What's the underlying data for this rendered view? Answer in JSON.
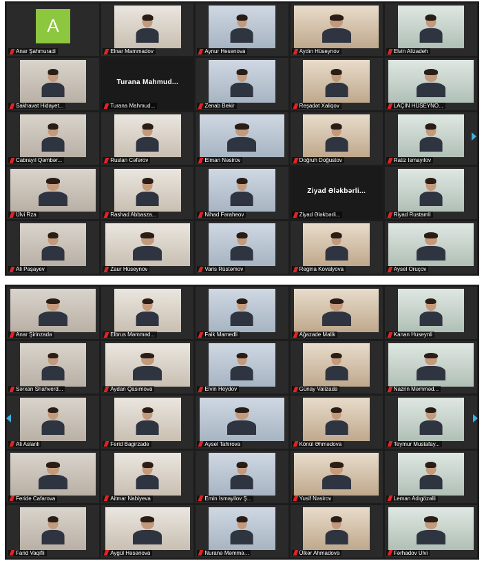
{
  "top_gallery": {
    "avatar_letter": "A",
    "tiles": [
      {
        "name": "Anar Şahmuradi",
        "mode": "avatar"
      },
      {
        "name": "Elnar Mammadov",
        "mode": "video"
      },
      {
        "name": "Aynur Hesenova",
        "mode": "video"
      },
      {
        "name": "Aydın Hüseynov",
        "mode": "video"
      },
      {
        "name": "Elvin Alizadeh",
        "mode": "video"
      },
      {
        "name": "Sakhavat Hidayet...",
        "mode": "video"
      },
      {
        "name": "Turana Mahmud...",
        "mode": "name"
      },
      {
        "name": "Zenab Bekir",
        "mode": "video"
      },
      {
        "name": "Reşadət Xaliqov",
        "mode": "video"
      },
      {
        "name": "LAÇIN HÜSEYNO...",
        "mode": "video"
      },
      {
        "name": "Cabrayıl Qəmbər...",
        "mode": "video"
      },
      {
        "name": "Ruslan Cəfərov",
        "mode": "video"
      },
      {
        "name": "Elman Nəsirov",
        "mode": "video"
      },
      {
        "name": "Doğruh Doğustov",
        "mode": "video"
      },
      {
        "name": "Ratiz Ismayılov",
        "mode": "video"
      },
      {
        "name": "Ülvi Rza",
        "mode": "video"
      },
      {
        "name": "Rashad Abbasza...",
        "mode": "video"
      },
      {
        "name": "Nihad Fəraheov",
        "mode": "video"
      },
      {
        "name": "Ziyad Ələkbərli...",
        "mode": "name"
      },
      {
        "name": "Riyad Rustamli",
        "mode": "video"
      },
      {
        "name": "Ali Paşayev",
        "mode": "video"
      },
      {
        "name": "Zaur Hüseynov",
        "mode": "video"
      },
      {
        "name": "Varis Rüstəmov",
        "mode": "video"
      },
      {
        "name": "Regina Kovalyova",
        "mode": "video"
      },
      {
        "name": "Aysel Oruçov",
        "mode": "video"
      }
    ]
  },
  "bottom_gallery": {
    "tiles": [
      {
        "name": "Anar Şirinzadə",
        "mode": "video"
      },
      {
        "name": "Elbrus Məmməd...",
        "mode": "video"
      },
      {
        "name": "Faik Mamedli",
        "mode": "video"
      },
      {
        "name": "Ağazade Malik",
        "mode": "video"
      },
      {
        "name": "Kanan Huseynli",
        "mode": "video"
      },
      {
        "name": "Sərxan Shahverd...",
        "mode": "video"
      },
      {
        "name": "Aydan Qasımova",
        "mode": "video"
      },
      {
        "name": "Elvin Heydov",
        "mode": "video"
      },
      {
        "name": "Günay Valizada",
        "mode": "video"
      },
      {
        "name": "Nazrin Məmməd...",
        "mode": "video"
      },
      {
        "name": "Ali Aslanli",
        "mode": "video"
      },
      {
        "name": "Ferid Bagirzade",
        "mode": "video"
      },
      {
        "name": "Aysel Tahirova",
        "mode": "video"
      },
      {
        "name": "Könül Əhmədova",
        "mode": "video"
      },
      {
        "name": "Teymur Mustafay...",
        "mode": "video"
      },
      {
        "name": "Feride Cafarova",
        "mode": "video"
      },
      {
        "name": "Aitmar Nabiyeva",
        "mode": "video"
      },
      {
        "name": "Emin Ismayilov Ş...",
        "mode": "video"
      },
      {
        "name": "Yusif Nəsirov",
        "mode": "video"
      },
      {
        "name": "Leman Adıgözəlli",
        "mode": "video"
      },
      {
        "name": "Farid Vaqifli",
        "mode": "video"
      },
      {
        "name": "Aygül Həsənova",
        "mode": "video"
      },
      {
        "name": "Nuranə Məmmə...",
        "mode": "video"
      },
      {
        "name": "Ülkər Ahmadova",
        "mode": "video"
      },
      {
        "name": "Fərhadov Ulvi",
        "mode": "video"
      }
    ]
  }
}
